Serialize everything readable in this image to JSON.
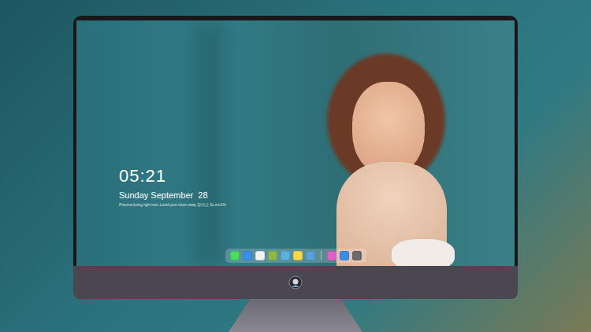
{
  "lock_screen": {
    "time": "05:21",
    "date": "Sunday September  28",
    "quote": "Pneuma loving right now. Loved your moon sway 잘자요 Sc.mrx1%"
  },
  "dock": {
    "apps": [
      {
        "color": "#4cd964"
      },
      {
        "color": "#3a8ee6"
      },
      {
        "color": "#f2f2f2"
      },
      {
        "color": "#8fb84a"
      },
      {
        "color": "#5bb0e0"
      },
      {
        "color": "#f7d94c"
      },
      {
        "color": "#5aa0d8"
      }
    ],
    "extras": [
      {
        "color": "#e060c8"
      },
      {
        "color": "#3b8be8"
      },
      {
        "color": "#6a6a6a"
      }
    ]
  }
}
